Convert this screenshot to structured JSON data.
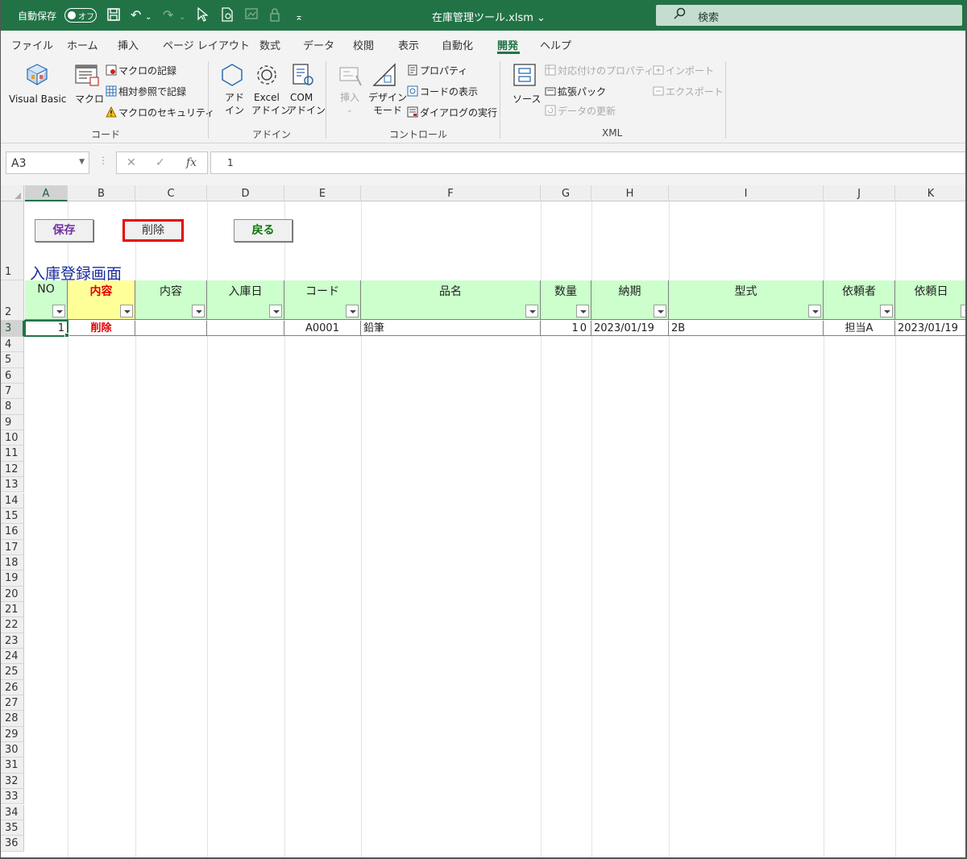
{
  "titlebar": {
    "autosave_label": "自動保存",
    "autosave_state": "オフ",
    "filename": "在庫管理ツール.xlsm",
    "search_placeholder": "検索"
  },
  "tabs": [
    "ファイル",
    "ホーム",
    "挿入",
    "ページ レイアウト",
    "数式",
    "データ",
    "校閲",
    "表示",
    "自動化",
    "開発",
    "ヘルプ"
  ],
  "active_tab": "開発",
  "ribbon": {
    "code": {
      "label": "コード",
      "visual_basic": "Visual Basic",
      "macro": "マクロ",
      "record_macro": "マクロの記録",
      "relative_ref": "相対参照で記録",
      "macro_security": "マクロのセキュリティ"
    },
    "addins": {
      "label": "アドイン",
      "addin_1": "アド",
      "addin_2": "イン",
      "excel_1": "Excel",
      "excel_2": "アドイン",
      "com_1": "COM",
      "com_2": "アドイン"
    },
    "controls": {
      "label": "コントロール",
      "insert": "挿入",
      "design_1": "デザイン",
      "design_2": "モード",
      "properties": "プロパティ",
      "view_code": "コードの表示",
      "run_dialog": "ダイアログの実行"
    },
    "xml": {
      "label": "XML",
      "source": "ソース",
      "map_properties": "対応付けのプロパティ",
      "expansion_packs": "拡張パック",
      "refresh_data": "データの更新",
      "import": "インポート",
      "export": "エクスポート"
    }
  },
  "formula_bar": {
    "name_box": "A3",
    "formula": "1"
  },
  "columns": [
    "A",
    "B",
    "C",
    "D",
    "E",
    "F",
    "G",
    "H",
    "I",
    "J",
    "K"
  ],
  "rows": [
    "1",
    "2",
    "3",
    "4",
    "5",
    "6",
    "7",
    "8",
    "9",
    "10",
    "11",
    "12",
    "13",
    "14",
    "15",
    "16",
    "17",
    "18",
    "19",
    "20",
    "21",
    "22",
    "23",
    "24",
    "25",
    "26",
    "27",
    "28",
    "29",
    "30",
    "31",
    "32",
    "33",
    "34",
    "35",
    "36"
  ],
  "sheet": {
    "buttons": {
      "save": "保存",
      "delete": "削除",
      "back": "戻る"
    },
    "title": "入庫登録画面",
    "headers": [
      "NO",
      "内容",
      "内容",
      "入庫日",
      "コード",
      "品名",
      "数量",
      "納期",
      "型式",
      "依頼者",
      "依頼日"
    ],
    "record": {
      "no": "1",
      "action": "削除",
      "content": "",
      "received_date": "",
      "code": "A0001",
      "item_name": "鉛筆",
      "quantity": "10",
      "due_date": "2023/01/19",
      "model": "2B",
      "requester": "担当A",
      "request_date": "2023/01/19"
    }
  }
}
